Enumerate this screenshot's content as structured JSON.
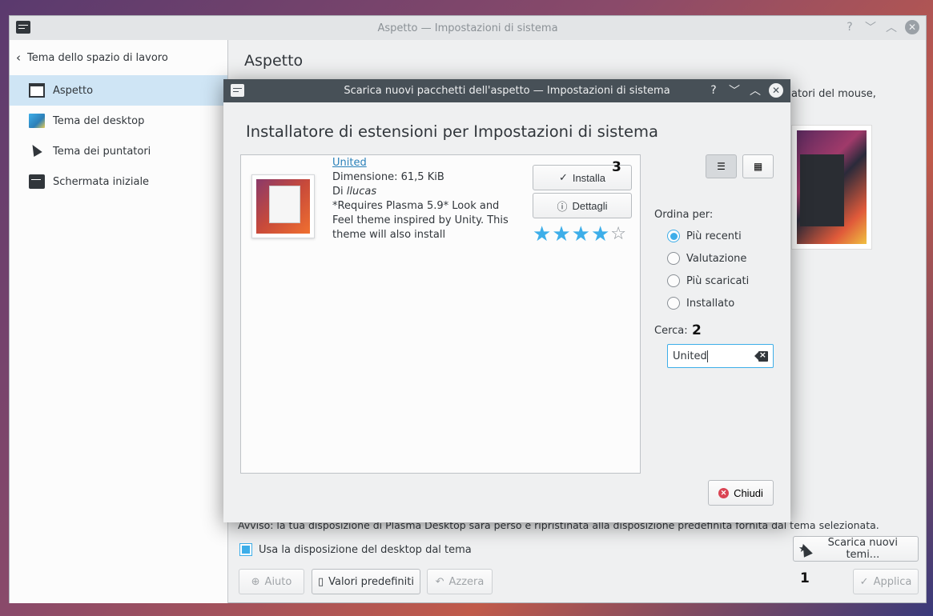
{
  "main_window": {
    "title": "Aspetto — Impostazioni di sistema",
    "help_glyph": "?",
    "min_glyph": "﹀",
    "max_glyph": "︿",
    "close_glyph": "✕"
  },
  "sidebar": {
    "back_label": "Tema dello spazio di lavoro",
    "items": [
      {
        "label": "Aspetto",
        "icon": "window-icon",
        "selected": true
      },
      {
        "label": "Tema del desktop",
        "icon": "desktop-theme-icon"
      },
      {
        "label": "Tema dei puntatori",
        "icon": "cursor-icon"
      },
      {
        "label": "Schermata iniziale",
        "icon": "splash-icon"
      }
    ]
  },
  "content": {
    "title": "Aspetto",
    "partial_text": "atori del mouse,",
    "warning": "Avviso: la tua disposizione di Plasma Desktop sarà perso e ripristinata alla disposizione predefinita fornita dal tema selezionata.",
    "use_layout_label": "Usa la disposizione del desktop dal tema",
    "use_layout_checked": true,
    "download_button": "Scarica nuovi temi...",
    "help_button": "Aiuto",
    "defaults_button": "Valori predefiniti",
    "reset_button": "Azzera",
    "apply_button": "Applica"
  },
  "dialog": {
    "title": "Scarica nuovi pacchetti dell'aspetto — Impostazioni di sistema",
    "heading": "Installatore di estensioni per Impostazioni di sistema",
    "item": {
      "name": "United",
      "size": "Dimensione: 61,5 KiB",
      "author_prefix": "Di ",
      "author": "llucas",
      "description": "*Requires Plasma 5.9* Look and Feel theme inspired by Unity. This theme will also install",
      "install_label": "Installa",
      "details_label": "Dettagli",
      "rating_stars": 4,
      "rating_max": 5
    },
    "sort_label": "Ordina per:",
    "sort_options": [
      {
        "label": "Più recenti",
        "checked": true
      },
      {
        "label": "Valutazione",
        "checked": false
      },
      {
        "label": "Più scaricati",
        "checked": false
      },
      {
        "label": "Installato",
        "checked": false
      }
    ],
    "search_label": "Cerca:",
    "search_value": "United",
    "close_label": "Chiudi"
  },
  "annotations": {
    "one": "1",
    "two": "2",
    "three": "3"
  },
  "colors": {
    "accent": "#3daee9",
    "dialog_titlebar": "#475057",
    "close_red": "#da4453"
  }
}
